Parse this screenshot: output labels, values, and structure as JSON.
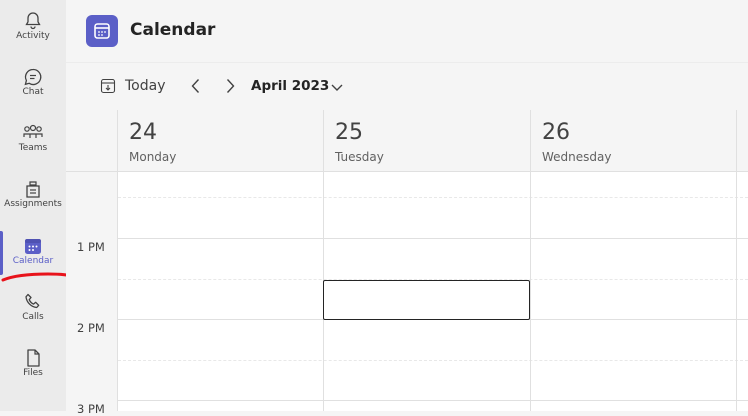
{
  "rail": {
    "items": [
      {
        "label": "Activity",
        "icon": "bell-icon"
      },
      {
        "label": "Chat",
        "icon": "chat-icon"
      },
      {
        "label": "Teams",
        "icon": "teams-icon"
      },
      {
        "label": "Assignments",
        "icon": "assignments-icon"
      },
      {
        "label": "Calendar",
        "icon": "calendar-icon",
        "active": true
      },
      {
        "label": "Calls",
        "icon": "phone-icon"
      },
      {
        "label": "Files",
        "icon": "file-icon"
      }
    ]
  },
  "header": {
    "title": "Calendar"
  },
  "toolbar": {
    "today_label": "Today",
    "month_label": "April 2023"
  },
  "calendar": {
    "days": [
      {
        "number": "24",
        "name": "Monday"
      },
      {
        "number": "25",
        "name": "Tuesday"
      },
      {
        "number": "26",
        "name": "Wednesday"
      }
    ],
    "times": [
      "1 PM",
      "2 PM",
      "3 PM"
    ]
  },
  "colors": {
    "accent": "#5b5fc7",
    "annotation": "#e8131b"
  }
}
